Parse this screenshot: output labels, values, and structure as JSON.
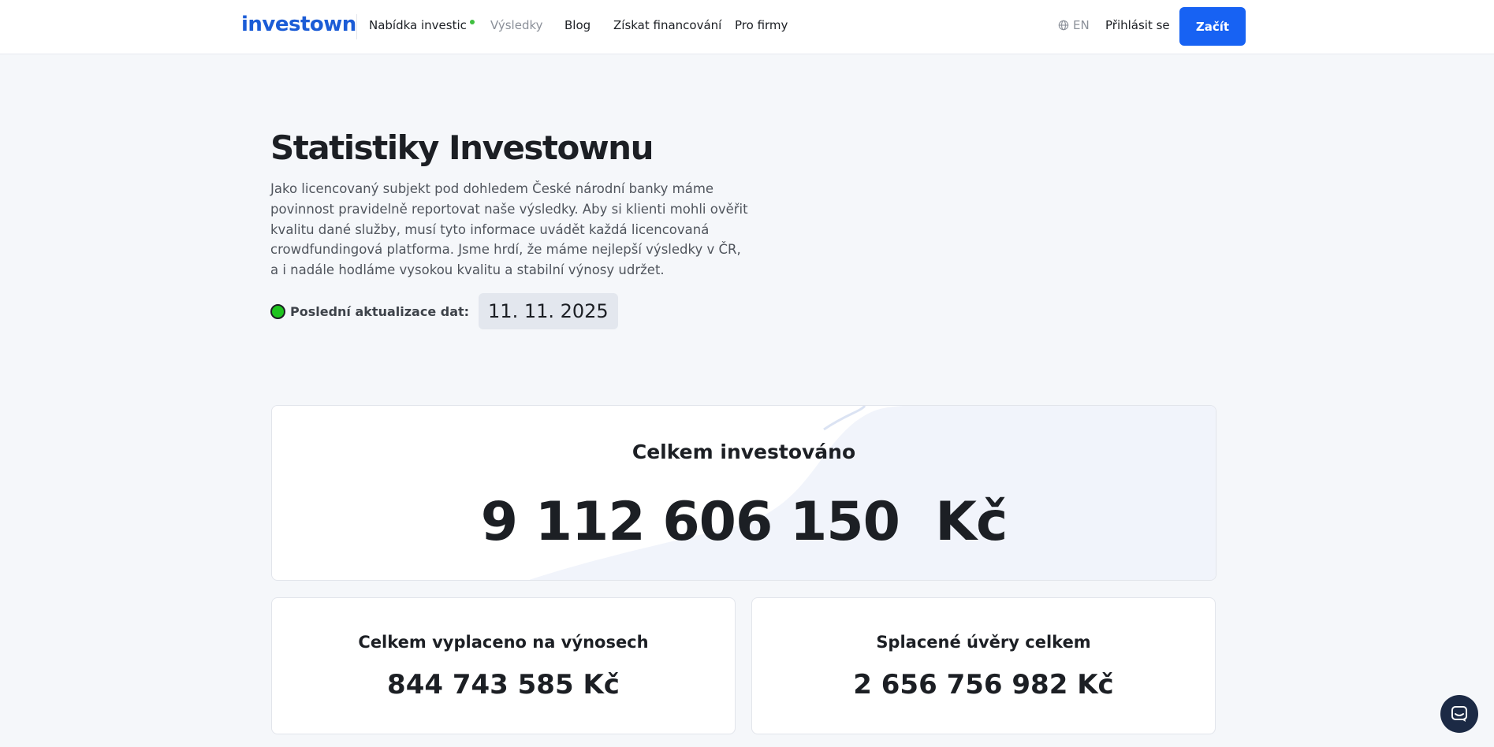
{
  "header": {
    "logo": "investown",
    "nav": [
      {
        "label": "Nabídka investic",
        "active": false,
        "has_dot": true
      },
      {
        "label": "Výsledky",
        "active": true,
        "has_dot": false
      },
      {
        "label": "Blog",
        "active": false,
        "has_dot": false
      },
      {
        "label": "Získat financování",
        "active": false,
        "has_dot": false
      },
      {
        "label": "Pro firmy",
        "active": false,
        "has_dot": false
      }
    ],
    "language": "EN",
    "login_label": "Přihlásit se",
    "cta_label": "Začít",
    "colors": {
      "brand": "#1b5cd6",
      "cta": "#1762f3",
      "new_dot": "#3fbf3f"
    }
  },
  "hero": {
    "title": "Statistiky Investownu",
    "intro": "Jako licencovaný subjekt pod dohledem České národní banky máme povinnost pravidelně reportovat naše výsledky. Aby si klienti mohli ověřit kvalitu dané služby, musí tyto informace uvádět každá licencovaná crowdfundingová platforma. Jsme hrdí, že máme nejlepší výsledky v ČR, a i nadále hodláme vysokou kvalitu a stabilní výnosy udržet.",
    "update_label": "Poslední aktualizace dat:",
    "update_date": "11. 11. 2025",
    "status_color": "#1ec41e"
  },
  "stats": {
    "total_invested": {
      "label": "Celkem investováno",
      "value": "9 112 606 150  Kč"
    },
    "paid_out_returns": {
      "label": "Celkem vyplaceno na výnosech",
      "value": "844 743 585 Kč"
    },
    "repaid_loans": {
      "label": "Splacené úvěry celkem",
      "value": "2 656 756 982 Kč"
    }
  },
  "chat": {
    "icon": "chat-icon"
  }
}
